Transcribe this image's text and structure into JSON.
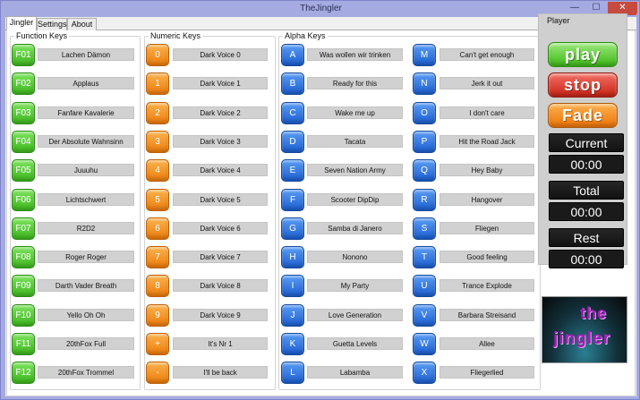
{
  "window": {
    "title": "TheJingler",
    "minimize": "—",
    "maximize": "☐",
    "close": "✕"
  },
  "tabs": [
    "Jingler",
    "Settings",
    "About"
  ],
  "groups": {
    "function": "Function Keys",
    "numeric": "Numeric Keys",
    "alpha": "Alpha Keys",
    "player": "Player"
  },
  "function_keys": [
    {
      "key": "F01",
      "label": "Lachen Dämon"
    },
    {
      "key": "F02",
      "label": "Applaus"
    },
    {
      "key": "F03",
      "label": "Fanfare Kavalerie"
    },
    {
      "key": "F04",
      "label": "Der Absolute Wahnsinn"
    },
    {
      "key": "F05",
      "label": "Juuuhu"
    },
    {
      "key": "F06",
      "label": "Lichtschwert"
    },
    {
      "key": "F07",
      "label": "R2D2"
    },
    {
      "key": "F08",
      "label": "Roger Roger"
    },
    {
      "key": "F09",
      "label": "Darth Vader Breath"
    },
    {
      "key": "F10",
      "label": "Yello Oh Oh"
    },
    {
      "key": "F11",
      "label": "20thFox Full"
    },
    {
      "key": "F12",
      "label": "20thFox Trommel"
    }
  ],
  "numeric_keys": [
    {
      "key": "0",
      "label": "Dark Voice 0"
    },
    {
      "key": "1",
      "label": "Dark Voice 1"
    },
    {
      "key": "2",
      "label": "Dark Voice 2"
    },
    {
      "key": "3",
      "label": "Dark Voice 3"
    },
    {
      "key": "4",
      "label": "Dark Voice 4"
    },
    {
      "key": "5",
      "label": "Dark Voice 5"
    },
    {
      "key": "6",
      "label": "Dark Voice 6"
    },
    {
      "key": "7",
      "label": "Dark Voice 7"
    },
    {
      "key": "8",
      "label": "Dark Voice 8"
    },
    {
      "key": "9",
      "label": "Dark Voice 9"
    },
    {
      "key": "+",
      "label": "It's Nr 1"
    },
    {
      "key": "-",
      "label": "I'll be back"
    }
  ],
  "alpha_keys_left": [
    {
      "key": "A",
      "label": "Was wollen wir trinken"
    },
    {
      "key": "B",
      "label": "Ready for this"
    },
    {
      "key": "C",
      "label": "Wake me up"
    },
    {
      "key": "D",
      "label": "Tacata"
    },
    {
      "key": "E",
      "label": "Seven Nation Army"
    },
    {
      "key": "F",
      "label": "Scooter DipDip"
    },
    {
      "key": "G",
      "label": "Samba di Janero"
    },
    {
      "key": "H",
      "label": "Nonono"
    },
    {
      "key": "I",
      "label": "My Party"
    },
    {
      "key": "J",
      "label": "Love Generation"
    },
    {
      "key": "K",
      "label": "Guetta Levels"
    },
    {
      "key": "L",
      "label": "Labamba"
    }
  ],
  "alpha_keys_right": [
    {
      "key": "M",
      "label": "Can't get enough"
    },
    {
      "key": "N",
      "label": "Jerk it out"
    },
    {
      "key": "O",
      "label": "I don't care"
    },
    {
      "key": "P",
      "label": "Hit the Road Jack"
    },
    {
      "key": "Q",
      "label": "Hey Baby"
    },
    {
      "key": "R",
      "label": "Hangover"
    },
    {
      "key": "S",
      "label": "Fliegen"
    },
    {
      "key": "T",
      "label": "Good feeling"
    },
    {
      "key": "U",
      "label": "Trance Explode"
    },
    {
      "key": "V",
      "label": "Barbara Streisand"
    },
    {
      "key": "W",
      "label": "Allee"
    },
    {
      "key": "X",
      "label": "Fliegerlied"
    }
  ],
  "player": {
    "play": "play",
    "stop": "stop",
    "fade": "Fade",
    "current_label": "Current",
    "current_time": "00:00",
    "total_label": "Total",
    "total_time": "00:00",
    "rest_label": "Rest",
    "rest_time": "00:00"
  },
  "logo": {
    "line1": "the",
    "line2": "jingler"
  },
  "colors": {
    "function_key": "#3fb81f",
    "numeric_key": "#ee7d0b",
    "alpha_key": "#1c5fd1",
    "play": "#3db816",
    "stop": "#c82214",
    "fade": "#ee7508",
    "logo_text": "#a11bb5"
  }
}
